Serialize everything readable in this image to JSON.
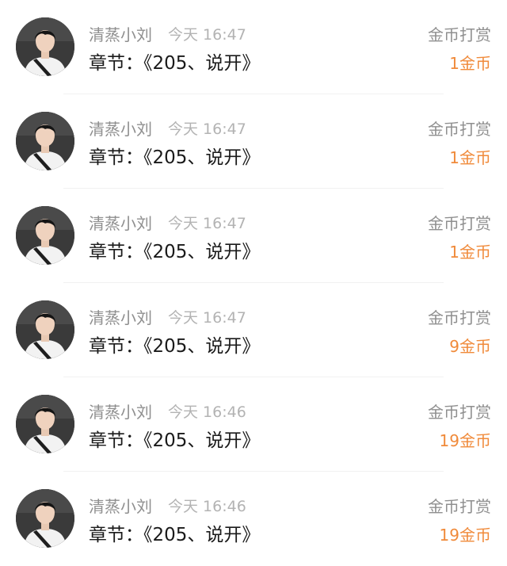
{
  "items": [
    {
      "name": "清蒸小刘",
      "time": "今天 16:47",
      "chapter": "章节：《205、说开》",
      "type": "金币打赏",
      "amount": "1金币",
      "avatar_icon": "user-avatar"
    },
    {
      "name": "清蒸小刘",
      "time": "今天 16:47",
      "chapter": "章节：《205、说开》",
      "type": "金币打赏",
      "amount": "1金币",
      "avatar_icon": "user-avatar"
    },
    {
      "name": "清蒸小刘",
      "time": "今天 16:47",
      "chapter": "章节：《205、说开》",
      "type": "金币打赏",
      "amount": "1金币",
      "avatar_icon": "user-avatar"
    },
    {
      "name": "清蒸小刘",
      "time": "今天 16:47",
      "chapter": "章节：《205、说开》",
      "type": "金币打赏",
      "amount": "9金币",
      "avatar_icon": "user-avatar"
    },
    {
      "name": "清蒸小刘",
      "time": "今天 16:46",
      "chapter": "章节：《205、说开》",
      "type": "金币打赏",
      "amount": "19金币",
      "avatar_icon": "user-avatar"
    },
    {
      "name": "清蒸小刘",
      "time": "今天 16:46",
      "chapter": "章节：《205、说开》",
      "type": "金币打赏",
      "amount": "19金币",
      "avatar_icon": "user-avatar"
    }
  ],
  "colors": {
    "amount": "#f08a3a",
    "name": "#8f8f8f",
    "time": "#b3b3b3",
    "chapter": "#1a1a1a"
  }
}
